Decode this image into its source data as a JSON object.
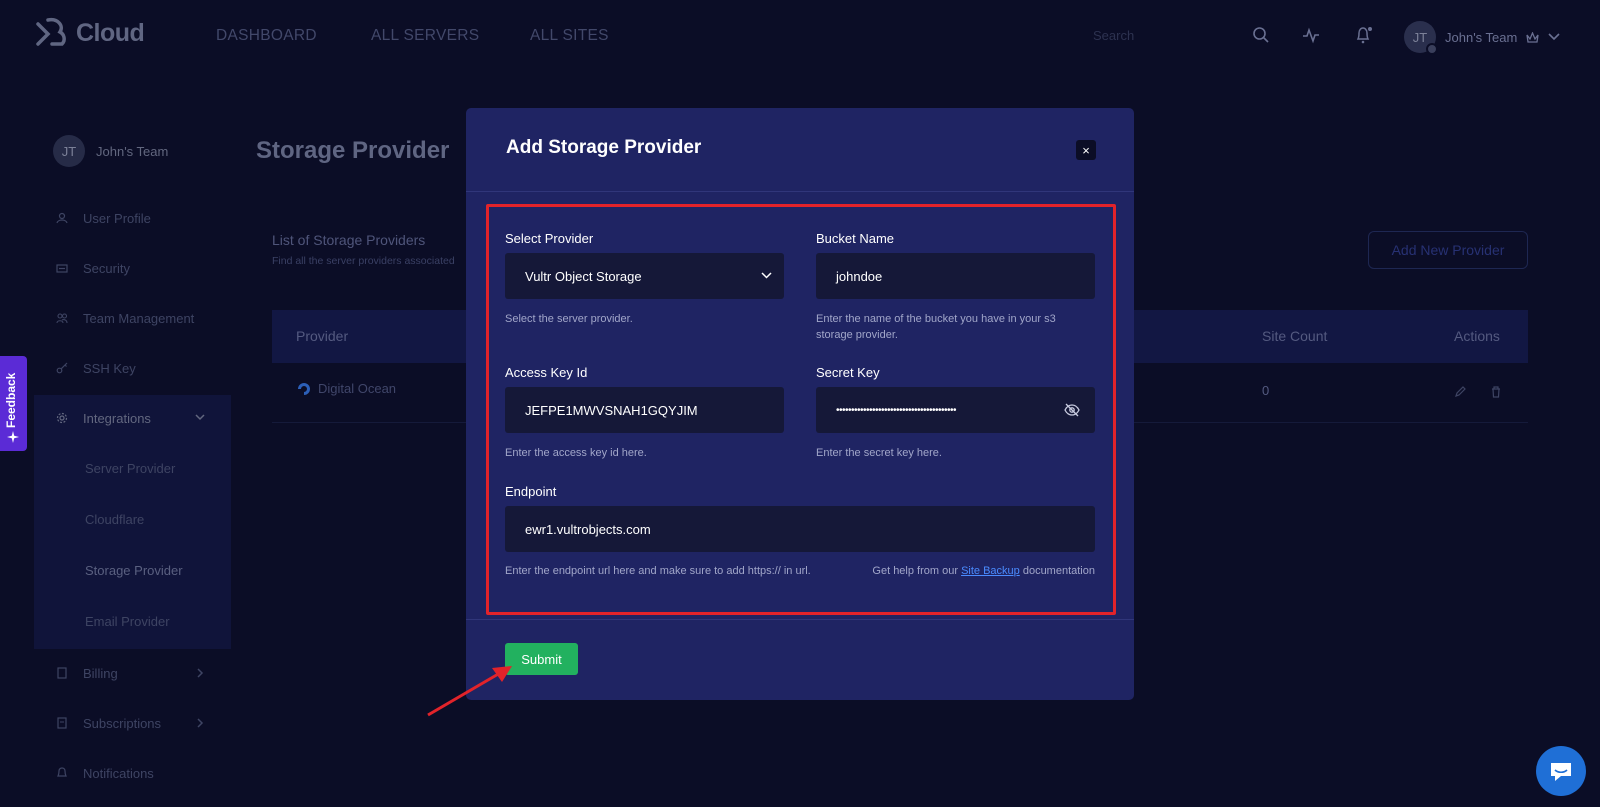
{
  "brand": {
    "name": "Cloud"
  },
  "nav": {
    "items": [
      "DASHBOARD",
      "ALL SERVERS",
      "ALL SITES"
    ]
  },
  "header": {
    "search_placeholder": "Search",
    "team_initials": "JT",
    "team_name": "John's Team"
  },
  "sidebar": {
    "team_initials": "JT",
    "team_name": "John's Team",
    "items": [
      "User Profile",
      "Security",
      "Team Management",
      "SSH Key",
      "Integrations",
      "Billing",
      "Subscriptions",
      "Notifications"
    ],
    "sub_items": [
      "Server Provider",
      "Cloudflare",
      "Storage Provider",
      "Email Provider"
    ]
  },
  "page": {
    "title": "Storage Provider",
    "list_title": "List of Storage Providers",
    "list_subtitle": "Find all the server providers associated",
    "add_button": "Add New Provider"
  },
  "table": {
    "headers": [
      "Provider",
      "Site Count",
      "Actions"
    ],
    "rows": [
      {
        "provider": "Digital Ocean",
        "site_count": "0"
      }
    ]
  },
  "feedback": {
    "label": "Feedback"
  },
  "modal": {
    "title": "Add Storage Provider",
    "close_label": "×",
    "provider": {
      "label": "Select Provider",
      "value": "Vultr Object Storage",
      "help": "Select the server provider."
    },
    "bucket": {
      "label": "Bucket Name",
      "value": "johndoe",
      "help": "Enter the name of the bucket you have in your s3 storage provider."
    },
    "access_key": {
      "label": "Access Key Id",
      "value": "JEFPE1MWVSNAH1GQYJIM",
      "help": "Enter the access key id here."
    },
    "secret_key": {
      "label": "Secret Key",
      "value": "••••••••••••••••••••••••••••••••••••••••",
      "help": "Enter the secret key here."
    },
    "endpoint": {
      "label": "Endpoint",
      "value": "ewr1.vultrobjects.com",
      "help": "Enter the endpoint url here and make sure to add https:// in url.",
      "doc_prefix": "Get help from our",
      "doc_link": "Site Backup",
      "doc_suffix": "documentation"
    },
    "submit": "Submit"
  },
  "colors": {
    "modal_bg": "#1f2463",
    "highlight": "#e2232a",
    "submit": "#22b15f",
    "link": "#4a8bff",
    "background": "#0b0d26"
  }
}
